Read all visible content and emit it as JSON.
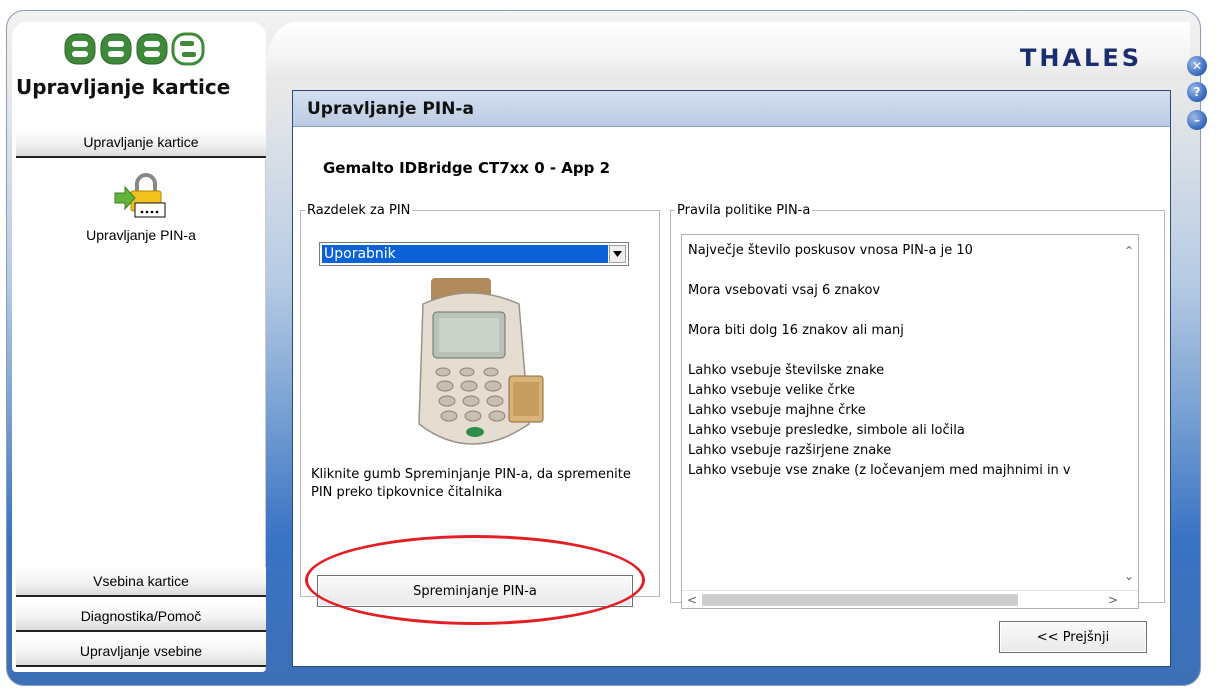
{
  "app": {
    "title": "Upravljanje kartice",
    "brand": "THALES",
    "logo_name": "ezees-logo"
  },
  "window_buttons": [
    {
      "name": "close",
      "glyph": "✕"
    },
    {
      "name": "help",
      "glyph": "?"
    },
    {
      "name": "minimize",
      "glyph": "–"
    }
  ],
  "sidebar": {
    "top_button": "Upravljanje kartice",
    "active_item": {
      "label": "Upravljanje PIN-a",
      "icon": "padlock-pin-icon"
    },
    "bottom_buttons": [
      "Vsebina kartice",
      "Diagnostika/Pomoč",
      "Upravljanje vsebine"
    ]
  },
  "main": {
    "title": "Upravljanje PIN-a",
    "reader": "Gemalto IDBridge CT7xx 0 - App 2",
    "pin_section": {
      "legend": "Razdelek za PIN",
      "selected": "Uporabnik",
      "hint": "Kliknite gumb Spreminjanje PIN-a, da spremenite PIN preko tipkovnice čitalnika",
      "button": "Spreminjanje PIN-a"
    },
    "policy": {
      "legend": "Pravila politike PIN-a",
      "lines": [
        "Največje število poskusov vnosa PIN-a je 10",
        "",
        "Mora vsebovati vsaj 6 znakov",
        "",
        "Mora biti dolg 16 znakov ali manj",
        "",
        "Lahko vsebuje številske znake",
        "Lahko vsebuje velike črke",
        "Lahko vsebuje majhne črke",
        "Lahko vsebuje presledke, simbole ali ločila",
        "Lahko vsebuje razširjene znake",
        "Lahko vsebuje vse znake (z ločevanjem med majhnimi in v"
      ]
    },
    "back_button": "<< Prejšnji"
  },
  "colors": {
    "highlight": "#e31e24",
    "selection": "#0a62d6",
    "brand": "#1a2d6e"
  }
}
